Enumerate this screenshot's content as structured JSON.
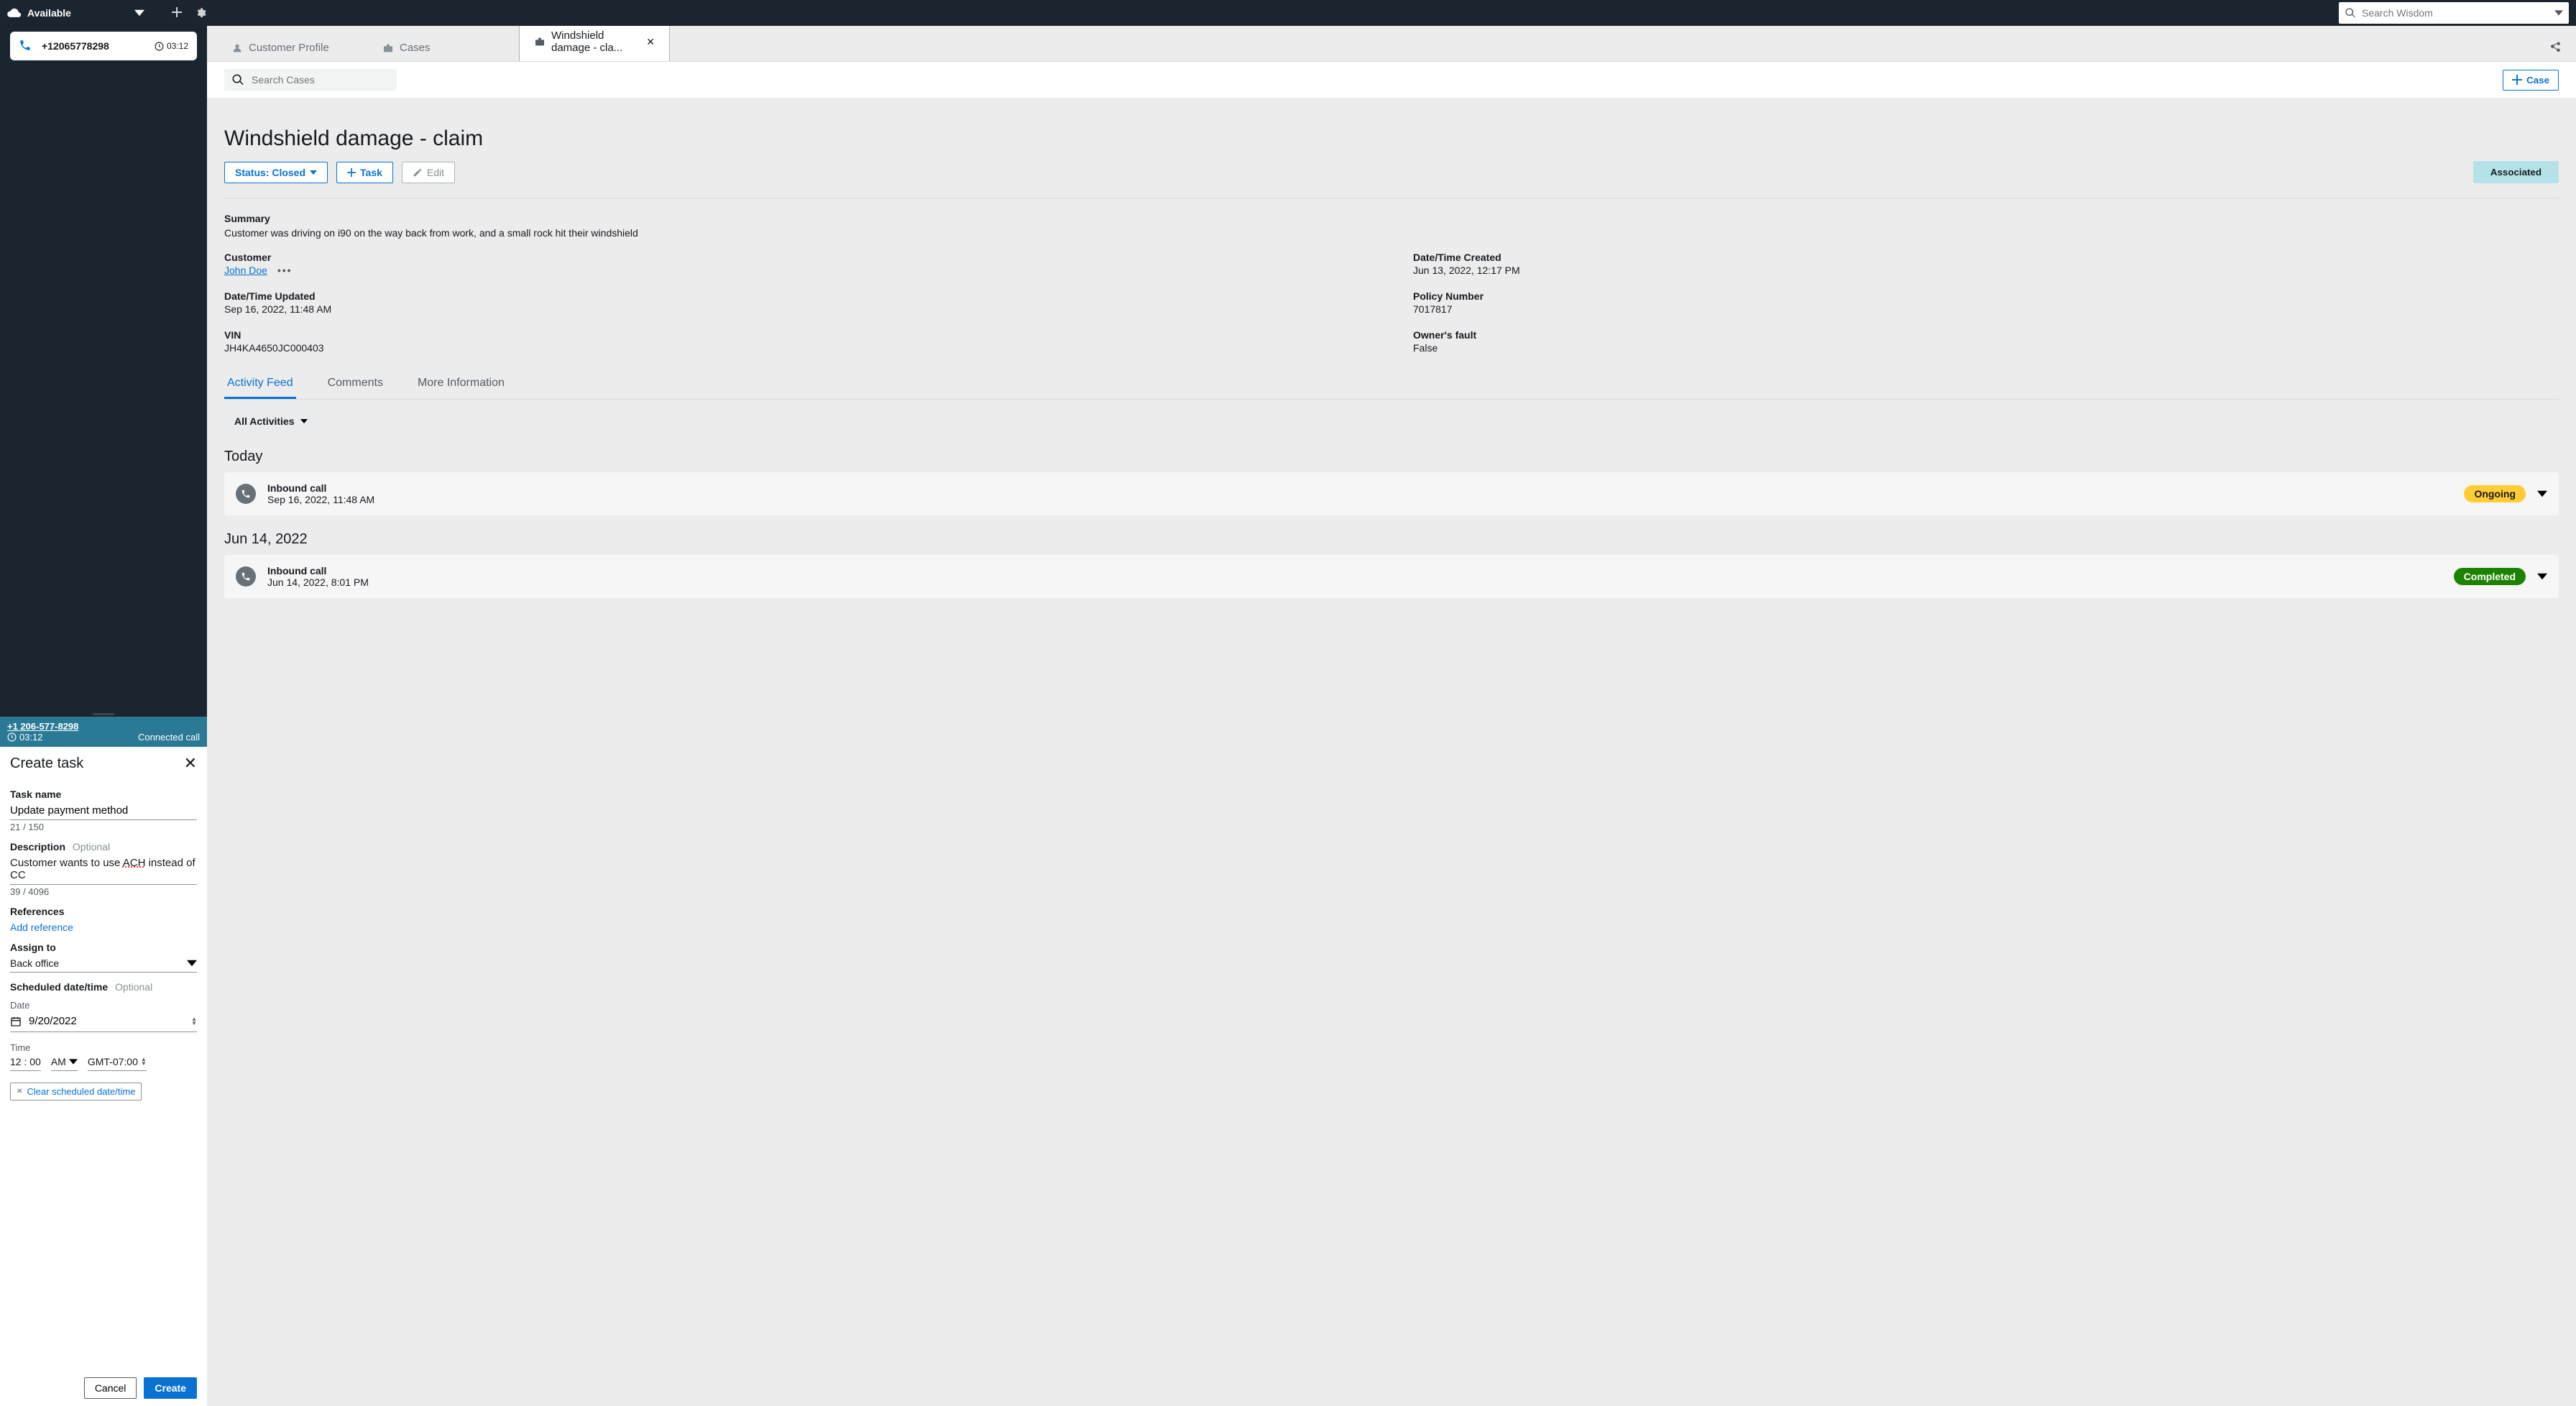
{
  "topbar": {
    "status": "Available",
    "search_placeholder": "Search Wisdom"
  },
  "contact": {
    "phone_display": "+12065778298",
    "timer": "03:12"
  },
  "session": {
    "phone": "+1 206-577-8298",
    "timer": "03:12",
    "status": "Connected call"
  },
  "task_form": {
    "title": "Create task",
    "name_label": "Task name",
    "name_value": "Update payment method",
    "name_counter": "21 / 150",
    "desc_label": "Description",
    "desc_optional": "Optional",
    "desc_plain_prefix": "Customer wants to use ",
    "desc_underlined": "ACH",
    "desc_plain_suffix": " instead of CC",
    "desc_counter": "39 / 4096",
    "refs_label": "References",
    "add_ref": "Add reference",
    "assign_label": "Assign to",
    "assign_value": "Back office",
    "sched_label": "Scheduled date/time",
    "sched_optional": "Optional",
    "date_label": "Date",
    "date_value": "9/20/2022",
    "time_label": "Time",
    "time_hhmm": "12 : 00",
    "time_ampm": "AM",
    "time_tz": "GMT-07:00",
    "clear_label": "Clear scheduled date/time",
    "cancel": "Cancel",
    "create": "Create"
  },
  "main_tabs": {
    "profile": "Customer Profile",
    "cases": "Cases",
    "active": "Windshield damage - cla..."
  },
  "case_toolbar": {
    "search_placeholder": "Search Cases",
    "add_case": "Case"
  },
  "case": {
    "title": "Windshield damage - claim",
    "status_label": "Status: Closed",
    "task_label": "Task",
    "edit_label": "Edit",
    "assoc_label": "Associated",
    "summary_label": "Summary",
    "summary_text": "Customer was driving on i90 on the way back from work, and a small rock hit their windshield",
    "fields": {
      "customer_label": "Customer",
      "customer_value": "John Doe",
      "created_label": "Date/Time Created",
      "created_value": "Jun 13, 2022, 12:17 PM",
      "updated_label": "Date/Time Updated",
      "updated_value": "Sep 16, 2022, 11:48 AM",
      "policy_label": "Policy Number",
      "policy_value": "7017817",
      "vin_label": "VIN",
      "vin_value": "JH4KA4650JC000403",
      "fault_label": "Owner's fault",
      "fault_value": "False"
    },
    "subtabs": {
      "feed": "Activity Feed",
      "comments": "Comments",
      "more": "More Information"
    },
    "filter": "All Activities",
    "feed": [
      {
        "day": "Today",
        "title": "Inbound call",
        "ts": "Sep 16, 2022, 11:48 AM",
        "badge": "Ongoing",
        "badge_class": "ongoing"
      },
      {
        "day": "Jun 14, 2022",
        "title": "Inbound call",
        "ts": "Jun 14, 2022, 8:01 PM",
        "badge": "Completed",
        "badge_class": "completed"
      }
    ]
  }
}
